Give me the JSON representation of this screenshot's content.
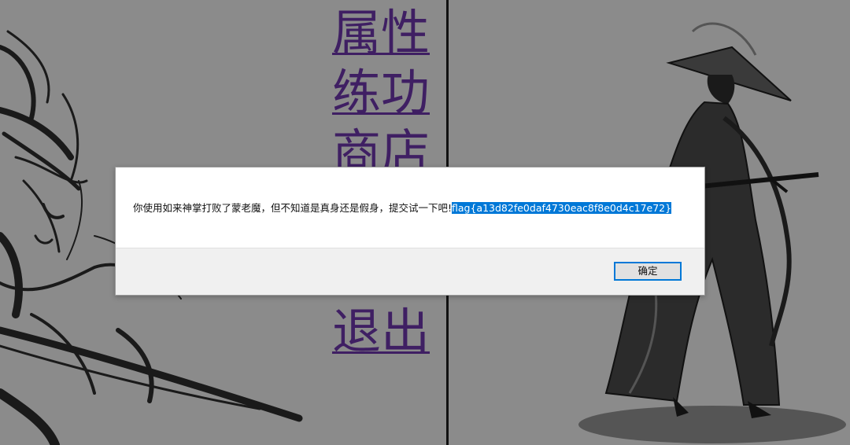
{
  "menu": {
    "items": [
      {
        "label": "属性"
      },
      {
        "label": "练功"
      },
      {
        "label": "商店"
      },
      {
        "label": "退出"
      }
    ],
    "link_color": "#3f1f63"
  },
  "dialog": {
    "message": "你使用如来神掌打败了蒙老魔，但不知道是真身还是假身，提交试一下吧!",
    "flag": "flag{a13d82fe0daf4730eac8f8e0d4c17e72}",
    "ok_label": "确定",
    "selection_color": "#0078d7"
  },
  "background": {
    "color": "#8b8b8b",
    "left_art": "ink-sketch-swordswoman",
    "right_art": "ink-sketch-samurai-with-straw-hat"
  }
}
